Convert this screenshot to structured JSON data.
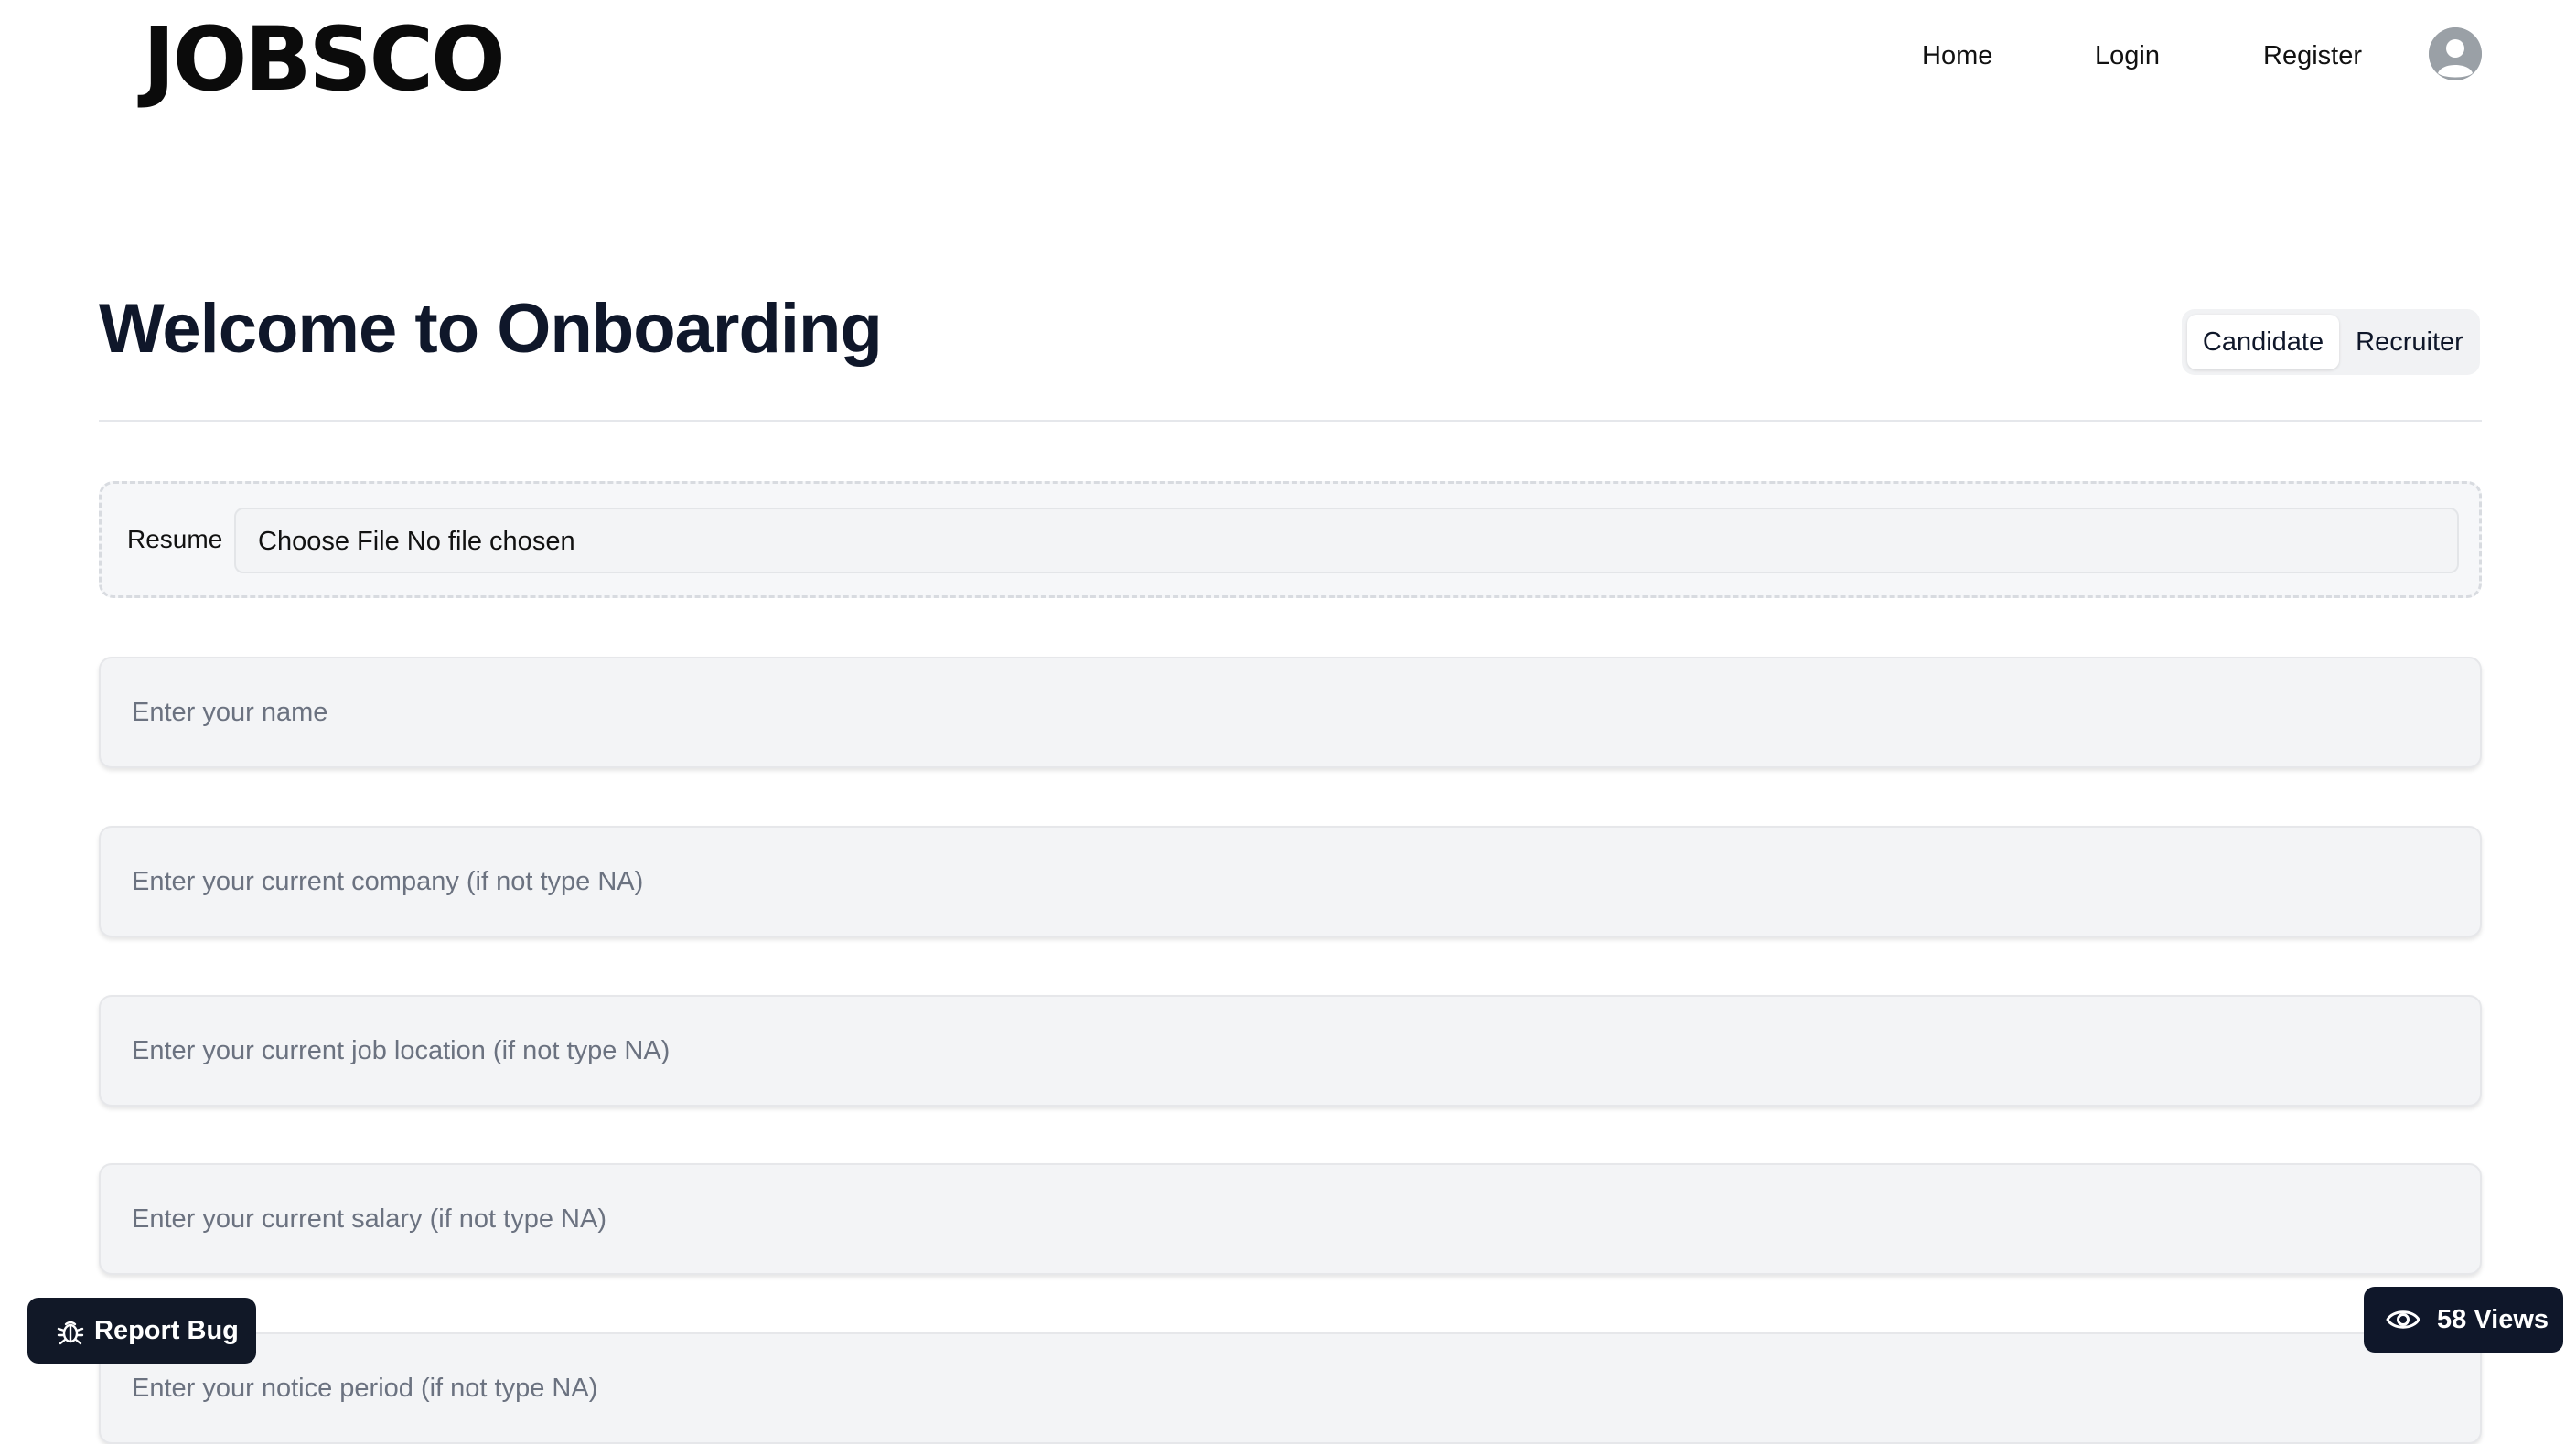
{
  "header": {
    "logo": "JOBSCO",
    "nav": {
      "home": "Home",
      "login": "Login",
      "register": "Register"
    },
    "avatar_icon": "user-avatar-icon"
  },
  "main": {
    "title": "Welcome to Onboarding",
    "role_toggle": {
      "candidate": "Candidate",
      "recruiter": "Recruiter",
      "selected": "Candidate"
    },
    "resume": {
      "label": "Resume",
      "file_input_text": "Choose File No file chosen"
    },
    "fields": {
      "name_placeholder": "Enter your name",
      "company_placeholder": "Enter your current company (if not type NA)",
      "location_placeholder": "Enter your current job location (if not type NA)",
      "salary_placeholder": "Enter your current salary (if not type NA)",
      "notice_placeholder": "Enter your notice period (if not type NA)"
    }
  },
  "floating": {
    "report_bug_label": "Report Bug",
    "report_bug_icon": "bug-icon",
    "views_label": "58 Views",
    "views_icon": "eye-icon"
  },
  "colors": {
    "dark_button": "#111827",
    "views_badge": "#0f172a",
    "field_bg": "#f3f4f6",
    "avatar_bg": "#9aa0a6"
  }
}
